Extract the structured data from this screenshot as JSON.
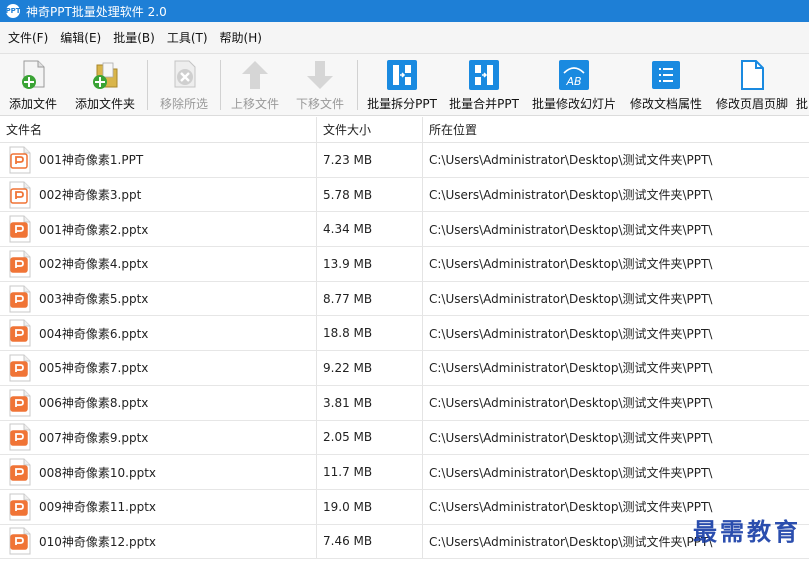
{
  "window": {
    "title": "神奇PPT批量处理软件 2.0",
    "app_icon_text": "PPT"
  },
  "menu": [
    "文件(F)",
    "编辑(E)",
    "批量(B)",
    "工具(T)",
    "帮助(H)"
  ],
  "toolbar": {
    "add_file": "添加文件",
    "add_folder": "添加文件夹",
    "remove_selected": "移除所选",
    "move_up": "上移文件",
    "move_down": "下移文件",
    "batch_split": "批量拆分PPT",
    "batch_merge": "批量合并PPT",
    "batch_modify_slides": "批量修改幻灯片",
    "modify_doc_props": "修改文档属性",
    "modify_header_footer": "修改页眉页脚",
    "more": "批"
  },
  "columns": {
    "name": "文件名",
    "size": "文件大小",
    "path": "所在位置"
  },
  "files": [
    {
      "name": "001神奇像素1.PPT",
      "size": "7.23 MB",
      "path": "C:\\Users\\Administrator\\Desktop\\测试文件夹\\PPT\\",
      "type": "ppt"
    },
    {
      "name": "002神奇像素3.ppt",
      "size": "5.78 MB",
      "path": "C:\\Users\\Administrator\\Desktop\\测试文件夹\\PPT\\",
      "type": "ppt"
    },
    {
      "name": "001神奇像素2.pptx",
      "size": "4.34 MB",
      "path": "C:\\Users\\Administrator\\Desktop\\测试文件夹\\PPT\\",
      "type": "pptx"
    },
    {
      "name": "002神奇像素4.pptx",
      "size": "13.9 MB",
      "path": "C:\\Users\\Administrator\\Desktop\\测试文件夹\\PPT\\",
      "type": "pptx"
    },
    {
      "name": "003神奇像素5.pptx",
      "size": "8.77 MB",
      "path": "C:\\Users\\Administrator\\Desktop\\测试文件夹\\PPT\\",
      "type": "pptx"
    },
    {
      "name": "004神奇像素6.pptx",
      "size": "18.8 MB",
      "path": "C:\\Users\\Administrator\\Desktop\\测试文件夹\\PPT\\",
      "type": "pptx"
    },
    {
      "name": "005神奇像素7.pptx",
      "size": "9.22 MB",
      "path": "C:\\Users\\Administrator\\Desktop\\测试文件夹\\PPT\\",
      "type": "pptx"
    },
    {
      "name": "006神奇像素8.pptx",
      "size": "3.81 MB",
      "path": "C:\\Users\\Administrator\\Desktop\\测试文件夹\\PPT\\",
      "type": "pptx"
    },
    {
      "name": "007神奇像素9.pptx",
      "size": "2.05 MB",
      "path": "C:\\Users\\Administrator\\Desktop\\测试文件夹\\PPT\\",
      "type": "pptx"
    },
    {
      "name": "008神奇像素10.pptx",
      "size": "11.7 MB",
      "path": "C:\\Users\\Administrator\\Desktop\\测试文件夹\\PPT\\",
      "type": "pptx"
    },
    {
      "name": "009神奇像素11.pptx",
      "size": "19.0 MB",
      "path": "C:\\Users\\Administrator\\Desktop\\测试文件夹\\PPT\\",
      "type": "pptx"
    },
    {
      "name": "010神奇像素12.pptx",
      "size": "7.46 MB",
      "path": "C:\\Users\\Administrator\\Desktop\\测试文件夹\\PPT\\",
      "type": "pptx"
    }
  ],
  "watermark": "最需教育",
  "colors": {
    "titlebar": "#1e7fd6",
    "accent_blue": "#1a8ae0",
    "ppt_orange": "#f07436",
    "add_green": "#3aa335"
  },
  "icons": {
    "add_file": "add-file-icon",
    "add_folder": "add-folder-icon",
    "remove": "remove-icon",
    "up": "arrow-up-icon",
    "down": "arrow-down-icon"
  }
}
